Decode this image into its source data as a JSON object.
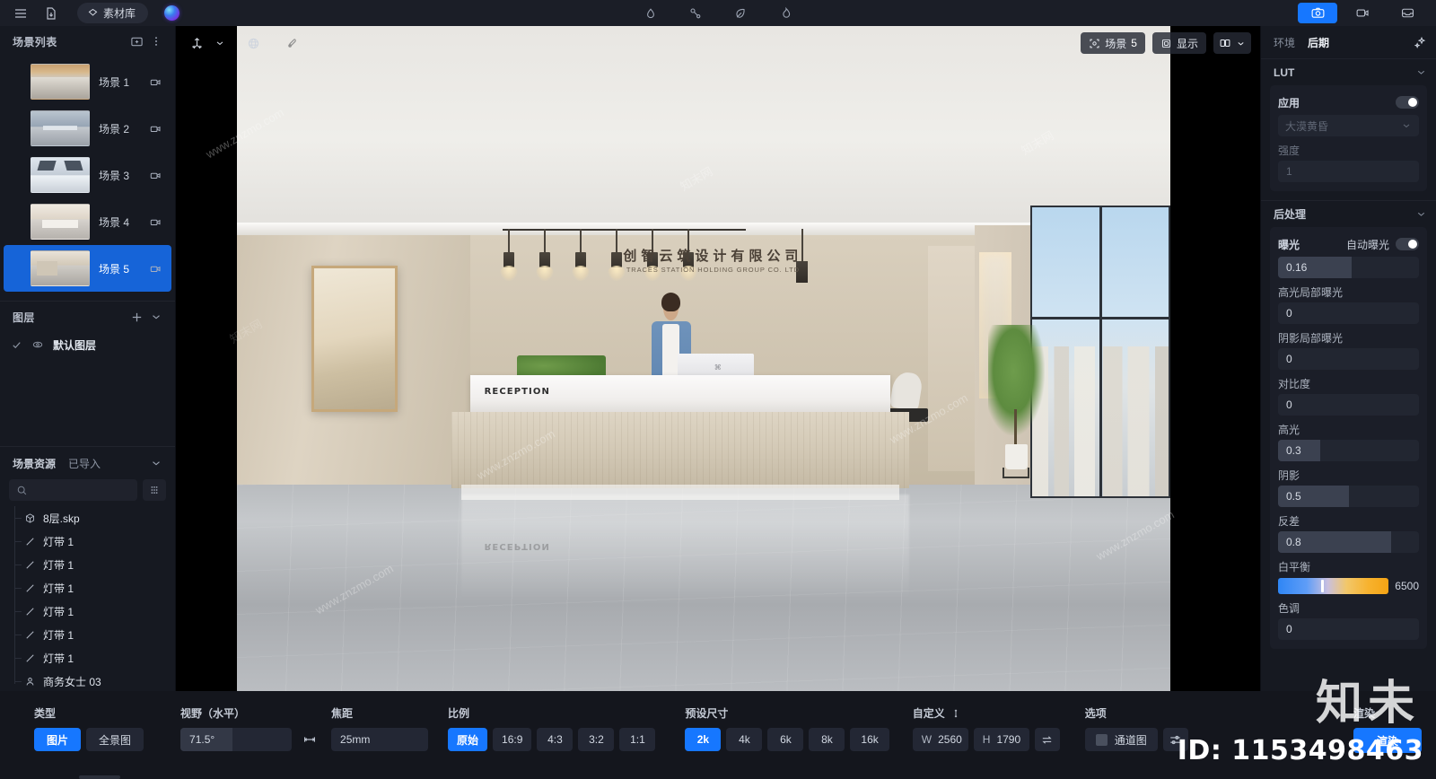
{
  "titlebar": {
    "menu_icon": "hamburger-icon",
    "file_icon": "file-download-icon",
    "library_label": "素材库",
    "library_icon": "diamond-icon",
    "center_icons": [
      "water-drop-icon",
      "node-link-icon",
      "leaf-icon",
      "flame-icon"
    ],
    "modes": [
      {
        "name": "photo-mode",
        "icon": "camera-icon",
        "active": true
      },
      {
        "name": "video-mode",
        "icon": "video-camera-icon",
        "active": false
      },
      {
        "name": "inbox-mode",
        "icon": "inbox-icon",
        "active": false
      }
    ]
  },
  "sidebar": {
    "scenes_title": "场景列表",
    "scenes_add_icon": "add-scene-icon",
    "scenes_more_icon": "more-vertical-icon",
    "scenes": [
      {
        "label": "场景 1",
        "selected": false,
        "thumb": "t1"
      },
      {
        "label": "场景 2",
        "selected": false,
        "thumb": "t2"
      },
      {
        "label": "场景 3",
        "selected": false,
        "thumb": "t3"
      },
      {
        "label": "场景 4",
        "selected": false,
        "thumb": "t4"
      },
      {
        "label": "场景 5",
        "selected": true,
        "thumb": "t5"
      }
    ],
    "layers_title": "图层",
    "layers_add_icon": "plus-icon",
    "layers_collapse_icon": "chevron-down-icon",
    "layers": [
      {
        "label": "默认图层",
        "visible_icon": "check-icon",
        "eye_icon": "eye-icon"
      }
    ],
    "resources_title": "场景资源",
    "resources_subtitle": "已导入",
    "resources_collapse_icon": "chevron-down-icon",
    "search_placeholder": "",
    "search_icon": "search-icon",
    "grid_icon": "grid-dots-icon",
    "resources": [
      {
        "label": "8层.skp",
        "icon": "cube-icon"
      },
      {
        "label": "灯带 1",
        "icon": "line-icon"
      },
      {
        "label": "灯带 1",
        "icon": "line-icon"
      },
      {
        "label": "灯带 1",
        "icon": "line-icon"
      },
      {
        "label": "灯带 1",
        "icon": "line-icon"
      },
      {
        "label": "灯带 1",
        "icon": "line-icon"
      },
      {
        "label": "灯带 1",
        "icon": "line-icon"
      },
      {
        "label": "商务女士 03",
        "icon": "person-icon"
      }
    ]
  },
  "viewport": {
    "move_icon": "move-axis-icon",
    "move_chevron_icon": "chevron-down-icon",
    "globe_icon": "globe-icon",
    "brush_icon": "brush-icon",
    "scene_badge_icon": "focus-frame-icon",
    "scene_badge_label": "场景",
    "scene_badge_value": "5",
    "display_icon": "cube-outline-icon",
    "display_label": "显示",
    "layout_icon": "layout-icon",
    "layout_chevron_icon": "chevron-down-icon",
    "render": {
      "sign_cn": "创智云筑设计有限公司",
      "sign_en": "TRACES STATION HOLDING GROUP CO. LTD",
      "desk_label": "RECEPTION"
    },
    "watermarks": [
      "www.znzmo.com",
      "知末网",
      "www.znzmo.com",
      "知末网",
      "www.znzmo.com",
      "知末网"
    ]
  },
  "right_panel": {
    "tab_environment": "环境",
    "tab_post": "后期",
    "sparkle_icon": "sparkle-icon",
    "lut": {
      "title": "LUT",
      "collapse_icon": "chevron-down-icon",
      "apply_label": "应用",
      "apply_on": false,
      "preset_value": "大漠黄昏",
      "preset_chevron_icon": "chevron-down-icon",
      "strength_label": "强度",
      "strength_value": "1"
    },
    "post": {
      "title": "后处理",
      "collapse_icon": "chevron-down-icon",
      "exposure_label": "曝光",
      "auto_exposure_label": "自动曝光",
      "auto_exposure_on": false,
      "exposure_value": "0.16",
      "exposure_fill_pct": 52,
      "fields": [
        {
          "label": "高光局部曝光",
          "value": "0",
          "fill_pct": 0
        },
        {
          "label": "阴影局部曝光",
          "value": "0",
          "fill_pct": 0
        },
        {
          "label": "对比度",
          "value": "0",
          "fill_pct": 0
        },
        {
          "label": "高光",
          "value": "0.3",
          "fill_pct": 30
        },
        {
          "label": "阴影",
          "value": "0.5",
          "fill_pct": 50
        },
        {
          "label": "反差",
          "value": "0.8",
          "fill_pct": 80
        }
      ],
      "white_balance_label": "白平衡",
      "white_balance_value": "6500",
      "white_balance_knob_pct": 39,
      "tone_label": "色调",
      "tone_value": "0"
    }
  },
  "bottombar": {
    "type_label": "类型",
    "type_options": [
      {
        "label": "图片",
        "active": true
      },
      {
        "label": "全景图",
        "active": false
      }
    ],
    "fov_label": "视野（水平）",
    "fov_value": "71.5°",
    "fov_fill_pct": 47,
    "link_icon": "link-range-icon",
    "focal_label": "焦距",
    "focal_value": "25mm",
    "ratio_label": "比例",
    "ratio_options": [
      {
        "label": "原始",
        "active": true
      },
      {
        "label": "16:9",
        "active": false
      },
      {
        "label": "4:3",
        "active": false
      },
      {
        "label": "3:2",
        "active": false
      },
      {
        "label": "1:1",
        "active": false
      }
    ],
    "preset_label": "预设尺寸",
    "preset_options": [
      {
        "label": "2k",
        "active": true
      },
      {
        "label": "4k",
        "active": false
      },
      {
        "label": "6k",
        "active": false
      },
      {
        "label": "8k",
        "active": false
      },
      {
        "label": "16k",
        "active": false
      }
    ],
    "custom_label": "自定义",
    "custom_lock_icon": "lock-link-icon",
    "width_label": "W",
    "width_value": "2560",
    "height_label": "H",
    "height_value": "1790",
    "swap_icon": "swap-icon",
    "options_label": "选项",
    "channel_label": "通道图",
    "channel_checked": false,
    "settings_icon": "sliders-icon",
    "render_label": "渲染"
  },
  "overlay": {
    "brand_watermark": "知未",
    "id_text": "ID: 1153498463"
  }
}
